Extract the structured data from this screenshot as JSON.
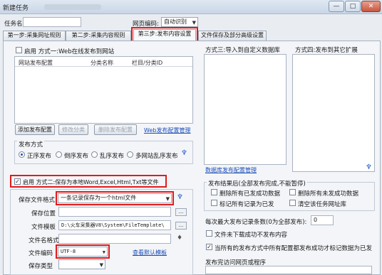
{
  "window": {
    "title": "新建任务",
    "min_label": "—",
    "max_label": "□",
    "close_label": "✕"
  },
  "task": {
    "name_label": "任务名:",
    "name_value": "",
    "encoding_label": "网页编码:",
    "encoding_value": "自动识别"
  },
  "tabs": [
    {
      "label": "第一步:采集网址规则"
    },
    {
      "label": "第二步:采集内容规则"
    },
    {
      "label": "第三步:发布内容设置"
    },
    {
      "label": "文件保存及部分高级设置"
    }
  ],
  "method1": {
    "enable_label": "启用 方式一:Web在线发布到网站",
    "col_config": "网站发布配置",
    "col_category": "分类名称",
    "col_id": "栏目/分类ID",
    "add_button": "添加发布配置",
    "edit_category_button": "修改分类",
    "delete_button": "删除发布配置",
    "manage_link": "Web发布配置管理",
    "publish_mode_label": "发布方式",
    "modes": [
      "正序发布",
      "倒序发布",
      "乱序发布",
      "多网站乱序发布"
    ]
  },
  "method3": {
    "title": "方式三:导入到自定义数据库",
    "manage_link": "数据库发布配置管理"
  },
  "method4": {
    "title": "方式四:发布到其它扩展"
  },
  "method2": {
    "enable_label": "启用 方式二:保存为本地Word,Excel,Html,Txt等文件",
    "save_format_label": "保存文件格式",
    "save_format_value": "一条记录保存为一个html文件",
    "save_location_label": "保存位置",
    "save_location_value": "",
    "template_label": "文件模板",
    "template_value": "D:\\火车采集器V8\\System\\FileTemplate\\",
    "filename_format_label": "文件名格式",
    "filename_format_value": "",
    "encoding_label": "文件编码",
    "encoding_value": "UTF-8",
    "view_template_link": "查看默认模板",
    "save_type_label": "保存类型",
    "save_type_value": "",
    "browse_label": "..."
  },
  "after_publish": {
    "title": "发布结果后(全部发布完成,不能暂停)",
    "options": [
      {
        "label": "删除所有已发成功数据",
        "checked": false
      },
      {
        "label": "删除所有未发成功数据",
        "checked": false
      },
      {
        "label": "标记所有记录为已发",
        "checked": false
      },
      {
        "label": "清空该任务网址库",
        "checked": false
      }
    ],
    "max_publish_label": "每次最大发布记录条数(0为全部发布):",
    "max_publish_value": "0",
    "no_publish_unfinished_label": "文件未下载成功不发布内容",
    "single_mark_label": "当所有的发布方式中所有配置都发布成功才标记数据为已发",
    "publish_complete_label": "发布完访问网页或程序",
    "publish_complete_value": ""
  },
  "colors": {
    "highlight": "#e21b1b",
    "link": "#1d4fb8"
  }
}
